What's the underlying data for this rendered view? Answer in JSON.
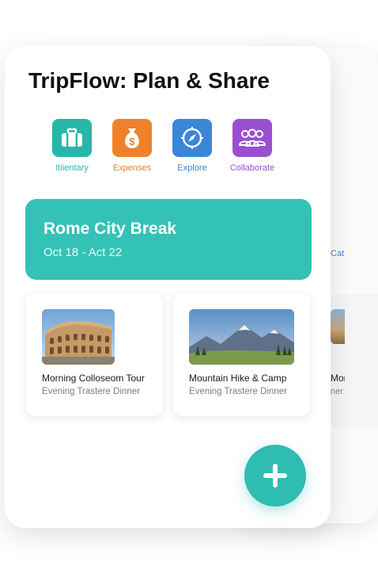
{
  "app": {
    "title": "TripFlow: Plan & Share"
  },
  "nav": {
    "items": [
      {
        "label": "Itiientary",
        "icon": "suitcase-icon",
        "color": "#27b7a8"
      },
      {
        "label": "Expenses",
        "icon": "money-bag-icon",
        "color": "#f0812b"
      },
      {
        "label": "Explore",
        "icon": "compass-icon",
        "color": "#3a86d8"
      },
      {
        "label": "Collaborate",
        "icon": "group-icon",
        "color": "#9a4fd0"
      }
    ]
  },
  "trip": {
    "title": "Rome City Break",
    "dates": "Oct 18 - Act 22",
    "color": "#34c2b6"
  },
  "activities": [
    {
      "title": "Morning Colloseom Tour",
      "subtitle": "Evening Trastere Dinner",
      "image": "colosseum-photo"
    },
    {
      "title": "Mountain Hike & Camp",
      "subtitle": "Evening Trastere Dinner",
      "image": "mountain-photo"
    }
  ],
  "background_card": {
    "label": "Cat",
    "activity_title": "Mon",
    "activity_subtitle": "ner"
  },
  "fab": {
    "icon": "plus-icon",
    "color": "#2fbcb1"
  }
}
